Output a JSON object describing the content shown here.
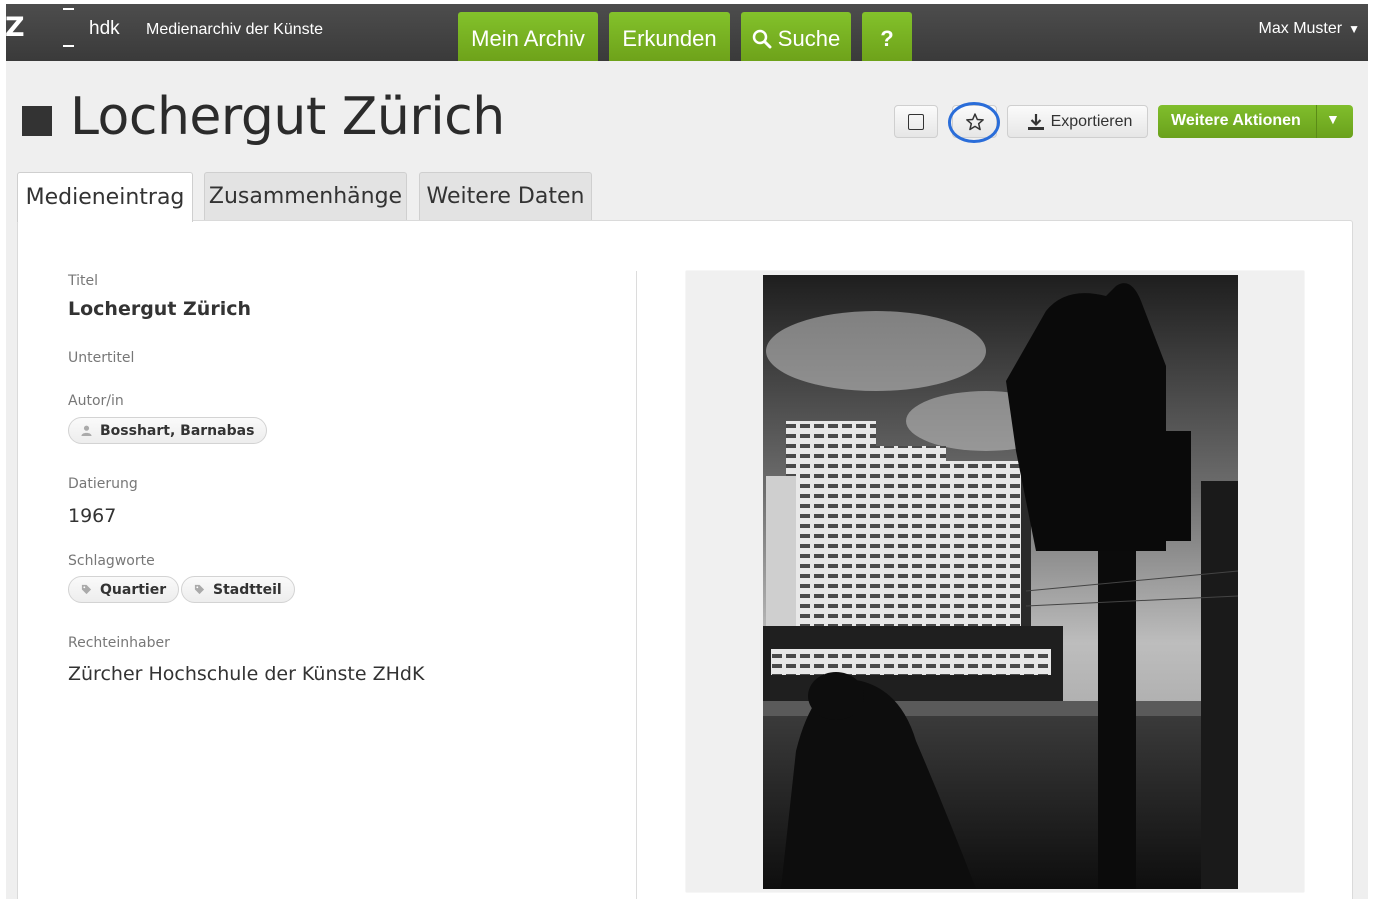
{
  "header": {
    "logo_z": "Z",
    "logo_hdk": "hdk",
    "app_title": "Medienarchiv der Künste",
    "nav": [
      {
        "label": "Mein Archiv",
        "icon": ""
      },
      {
        "label": "Erkunden",
        "icon": ""
      },
      {
        "label": "Suche",
        "icon": "search-icon"
      },
      {
        "label": "?",
        "icon": ""
      }
    ],
    "user": "Max Muster",
    "user_caret": "▼"
  },
  "entry": {
    "title": "Lochergut Zürich",
    "actions": {
      "select_icon": "checkbox-icon",
      "favorite_icon": "star-icon",
      "export_label": "Exportieren",
      "more_label": "Weitere Aktionen",
      "more_caret": "▼"
    }
  },
  "tabs": [
    {
      "label": "Medieneintrag",
      "active": true
    },
    {
      "label": "Zusammenhänge",
      "active": false
    },
    {
      "label": "Weitere Daten",
      "active": false
    }
  ],
  "fields": {
    "titel_label": "Titel",
    "titel_value": "Lochergut Zürich",
    "untertitel_label": "Untertitel",
    "autor_label": "Autor/in",
    "autor_value": "Bosshart, Barnabas",
    "datierung_label": "Datierung",
    "datierung_value": "1967",
    "schlagworte_label": "Schlagworte",
    "schlagworte": [
      "Quartier",
      "Stadtteil"
    ],
    "rechteinhaber_label": "Rechteinhaber",
    "rechteinhaber_value": "Zürcher Hochschule der Künste ZHdK"
  },
  "colors": {
    "topbar": "#404040",
    "accent_green": "#77b022",
    "focus_ring": "#2a6dd9"
  }
}
